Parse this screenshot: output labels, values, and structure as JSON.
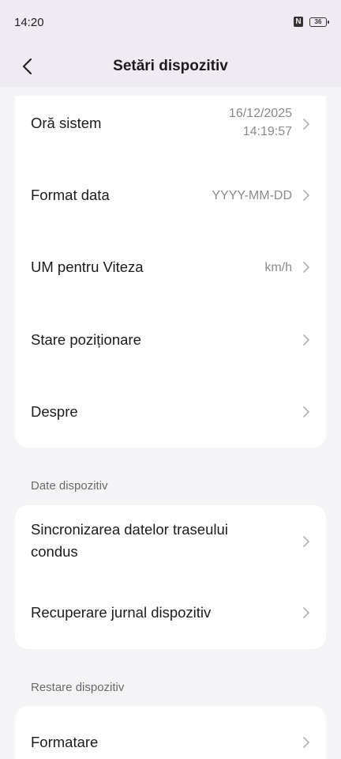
{
  "status_bar": {
    "time": "14:20",
    "nfc_label": "N",
    "battery_level": "36"
  },
  "header": {
    "title": "Setări dispozitiv"
  },
  "general": {
    "items": [
      {
        "label": "Oră sistem",
        "value_line1": "16/12/2025",
        "value_line2": "14:19:57"
      },
      {
        "label": "Format data",
        "value": "YYYY-MM-DD"
      },
      {
        "label": "UM pentru Viteza",
        "value": "km/h"
      },
      {
        "label": "Stare poziționare"
      },
      {
        "label": "Despre"
      }
    ]
  },
  "device_data": {
    "section_title": "Date dispozitiv",
    "items": [
      {
        "label_line1": "Sincronizarea datelor traseului",
        "label_line2": "condus"
      },
      {
        "label": "Recuperare jurnal dispozitiv"
      }
    ]
  },
  "device_restore": {
    "section_title": "Restare dispozitiv",
    "items": [
      {
        "label": "Formatare"
      }
    ]
  },
  "colors": {
    "header_bg": "#eeecf2",
    "page_bg": "#f4f4f6",
    "card_bg": "#ffffff",
    "secondary_text": "#8b8b8b"
  }
}
